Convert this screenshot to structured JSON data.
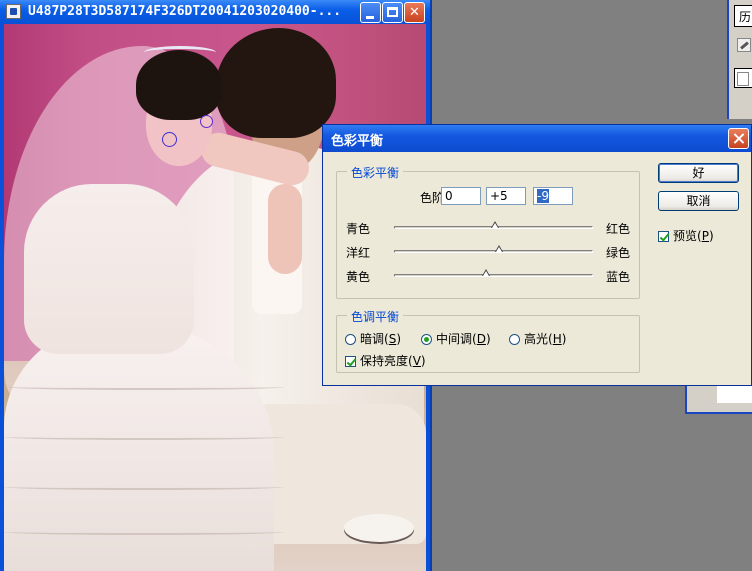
{
  "document_window": {
    "title": "U487P28T3D587174F326DT20041203020400-...",
    "minimize_glyph": "",
    "maximize_glyph": "",
    "close_glyph": "✕"
  },
  "history_panel": {
    "tab_label": "历"
  },
  "color_balance_dialog": {
    "title": "色彩平衡",
    "color_balance_group_label": "色彩平衡",
    "levels": {
      "label_prefix": "色阶(",
      "label_key": "L",
      "label_suffix": "):",
      "values": [
        "0",
        "+5",
        "-9"
      ]
    },
    "sliders": [
      {
        "left": "青色",
        "right": "红色",
        "value": 0
      },
      {
        "left": "洋红",
        "right": "绿色",
        "value": 5
      },
      {
        "left": "黄色",
        "right": "蓝色",
        "value": -9
      }
    ],
    "tone_balance": {
      "group_label": "色调平衡",
      "options": [
        {
          "label": "暗调(",
          "key": "S",
          "suffix": ")",
          "checked": false
        },
        {
          "label": "中间调(",
          "key": "D",
          "suffix": ")",
          "checked": true
        },
        {
          "label": "高光(",
          "key": "H",
          "suffix": ")",
          "checked": false
        }
      ],
      "preserve_luminosity": {
        "label": "保持亮度(",
        "key": "V",
        "suffix": ")",
        "checked": true
      }
    },
    "buttons": {
      "ok": "好",
      "cancel": "取消"
    },
    "preview": {
      "label": "预览(",
      "key": "P",
      "suffix": ")",
      "checked": true
    }
  },
  "colors": {
    "titlebar_blue": "#0a5ee8",
    "dialog_face": "#ece9d8",
    "group_label_blue": "#0046d5",
    "workspace_gray": "#808080"
  }
}
